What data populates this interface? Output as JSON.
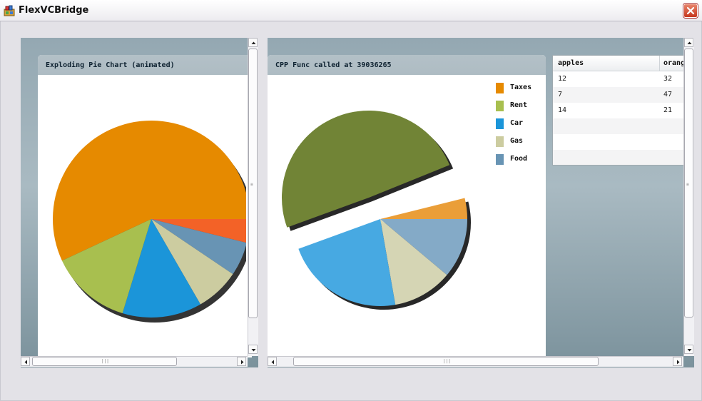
{
  "window": {
    "title": "FlexVCBridge"
  },
  "left_panel": {
    "title": "Exploding Pie Chart (animated)",
    "slice_colors": [
      "#e68a00",
      "#f36227",
      "#6894b4",
      "#cccca0",
      "#1b95d9",
      "#a8bf4f"
    ]
  },
  "right_panel": {
    "title": "CPP Func called at 39036265",
    "legend": [
      {
        "label": "Taxes",
        "color": "#e68a00"
      },
      {
        "label": "Rent",
        "color": "#a8bf4f"
      },
      {
        "label": "Car",
        "color": "#1b95d9"
      },
      {
        "label": "Gas",
        "color": "#cccca0"
      },
      {
        "label": "Food",
        "color": "#6894b4"
      }
    ],
    "slice_colors": [
      "#ea9e38",
      "#84aac7",
      "#d5d5b4",
      "#47a9e2",
      "#718436"
    ]
  },
  "grid": {
    "columns": [
      "apples",
      "oranges"
    ],
    "rows": [
      [
        "12",
        "32"
      ],
      [
        "7",
        "47"
      ],
      [
        "14",
        "21"
      ],
      [
        "",
        ""
      ],
      [
        "",
        ""
      ],
      [
        "",
        ""
      ]
    ]
  },
  "colors": {
    "close": "#c6361d",
    "pane": "#94a8b2"
  }
}
